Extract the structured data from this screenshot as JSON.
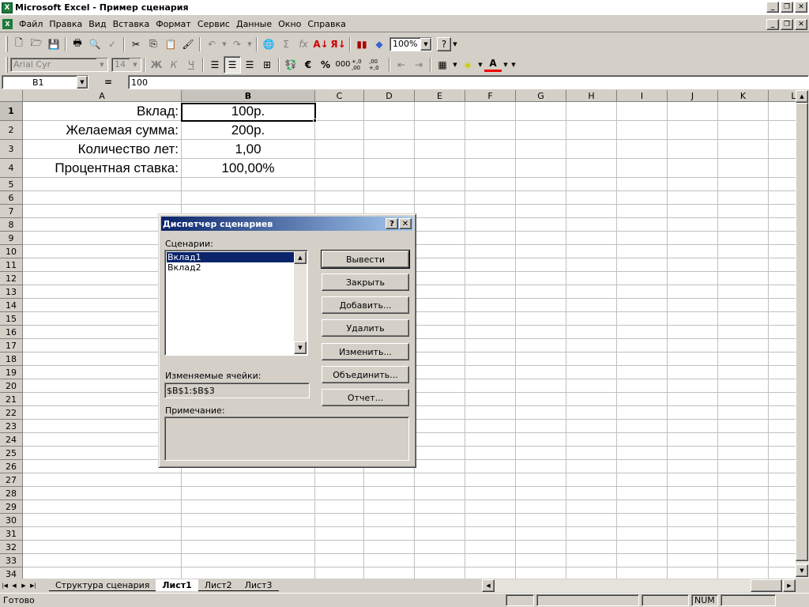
{
  "app": {
    "title": "Microsoft Excel - Пример сценария",
    "icon_letter": "X"
  },
  "menu": {
    "items": [
      "Файл",
      "Правка",
      "Вид",
      "Вставка",
      "Формат",
      "Сервис",
      "Данные",
      "Окно",
      "Справка"
    ]
  },
  "toolbar": {
    "zoom": "100%",
    "font_name": "Arial Cyr",
    "font_size": "14",
    "bold": "Ж",
    "italic": "К",
    "underline": "Ч",
    "currency": "€",
    "percent": "%",
    "thousands": "000",
    "inc_decimal": "+,0 ,00",
    "dec_decimal": ",00 +,0",
    "sigma": "Σ",
    "fx": "fx"
  },
  "formula_bar": {
    "name_box": "B1",
    "equals": "=",
    "value": "100"
  },
  "columns": [
    "A",
    "B",
    "C",
    "D",
    "E",
    "F",
    "G",
    "H",
    "I",
    "J",
    "K",
    "L"
  ],
  "rows": [
    "1",
    "2",
    "3",
    "4",
    "5",
    "6",
    "7",
    "8",
    "9",
    "10",
    "11",
    "12",
    "13",
    "14",
    "15",
    "16",
    "17",
    "18",
    "19",
    "20",
    "21",
    "22",
    "23",
    "24",
    "25",
    "26",
    "27",
    "28",
    "29",
    "30",
    "31",
    "32",
    "33",
    "34"
  ],
  "cells": [
    {
      "a": "Вклад:",
      "b": "100р."
    },
    {
      "a": "Желаемая сумма:",
      "b": "200р."
    },
    {
      "a": "Количество лет:",
      "b": "1,00"
    },
    {
      "a": "Процентная ставка:",
      "b": "100,00%"
    }
  ],
  "sheets": {
    "tabs": [
      "Структура сценария",
      "Лист1",
      "Лист2",
      "Лист3"
    ],
    "active": "Лист1"
  },
  "status": {
    "text": "Готово",
    "num": "NUM"
  },
  "dialog": {
    "title": "Диспетчер сценариев",
    "help": "?",
    "close": "✕",
    "scenarios_label": "Сценарии:",
    "scenarios": [
      "Вклад1",
      "Вклад2"
    ],
    "selected_scenario": "Вклад1",
    "changing_cells_label": "Изменяемые ячейки:",
    "changing_cells": "$B$1:$B$3",
    "note_label": "Примечание:",
    "note": "",
    "buttons": {
      "show": "Вывести",
      "close": "Закрыть",
      "add": "Добавить...",
      "delete": "Удалить",
      "edit": "Изменить...",
      "merge": "Объединить...",
      "report": "Отчет..."
    }
  }
}
